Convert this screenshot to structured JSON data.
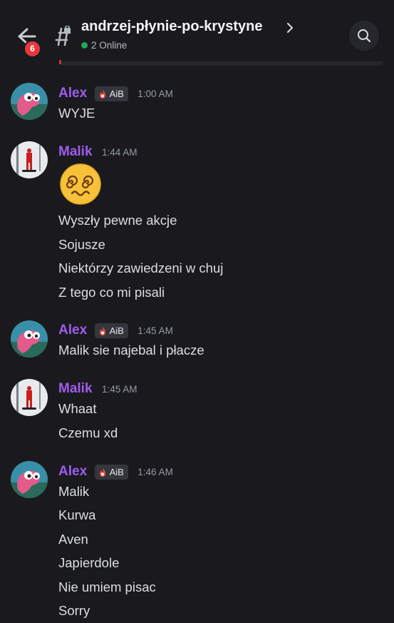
{
  "header": {
    "unread_count": "6",
    "channel_name": "andrzej-płynie-po-krystyne",
    "online_text": "2 Online"
  },
  "colors": {
    "background": "#1a1a1e",
    "username": "#a05cf0",
    "online": "#23a55a",
    "badge": "#e5393f"
  },
  "messages": [
    {
      "author": "Alex",
      "tag": "AiB",
      "time": "1:00 AM",
      "lines": [
        "WYJE"
      ]
    },
    {
      "author": "Malik",
      "time": "1:44 AM",
      "emoji": "dizzy-face-emoji",
      "lines": [
        "Wyszły pewne akcje",
        "Sojusze",
        "Niektórzy zawiedzeni w chuj",
        "Z tego co mi pisali"
      ]
    },
    {
      "author": "Alex",
      "tag": "AiB",
      "time": "1:45 AM",
      "lines": [
        "Malik sie najebal i płacze"
      ]
    },
    {
      "author": "Malik",
      "time": "1:45 AM",
      "lines": [
        "Whaat",
        "Czemu xd"
      ]
    },
    {
      "author": "Alex",
      "tag": "AiB",
      "time": "1:46 AM",
      "lines": [
        "Malik",
        "Kurwa",
        "Aven",
        "Japierdole",
        "Nie umiem pisac",
        "Sorry"
      ]
    }
  ]
}
